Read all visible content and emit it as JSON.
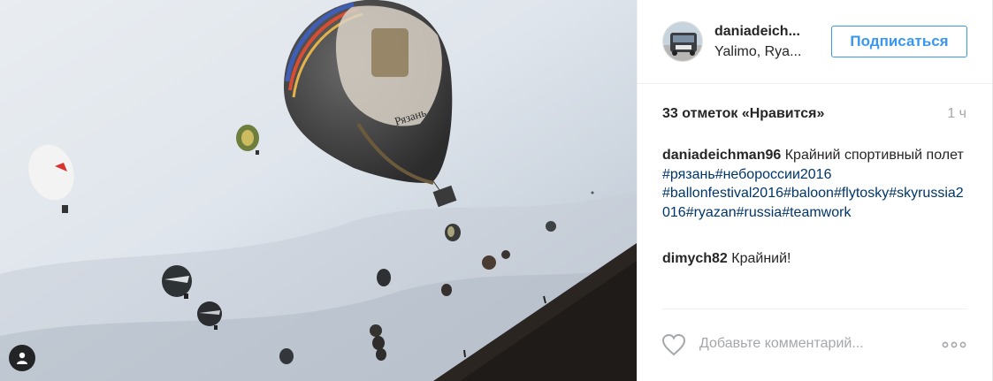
{
  "post": {
    "username": "daniadeich...",
    "location": "Yalimo, Rya...",
    "follow_label": "Подписаться",
    "likes_label": "33 отметок «Нравится»",
    "time_ago": "1 ч"
  },
  "caption": {
    "author": "daniadeichman96",
    "text": " Крайний спортивный полет ",
    "hashtags": [
      "#рязань",
      "#небороссии2016",
      "#ballonfestival2016",
      "#baloon",
      "#flytosky",
      "#skyrussia2016",
      "#ryazan",
      "#russia",
      "#teamwork"
    ]
  },
  "comments": [
    {
      "author": "dimych82",
      "text": " Крайний!"
    }
  ],
  "footer": {
    "add_comment_placeholder": "Добавьте комментарий..."
  },
  "photo_text": {
    "balloon_label": "Рязань"
  },
  "icons": {
    "heart": "heart-icon",
    "more": "more-options-icon",
    "user_tag": "user-tag-icon"
  },
  "colors": {
    "link": "#003569",
    "follow_button": "#3897f0",
    "muted": "#a5a7aa"
  }
}
